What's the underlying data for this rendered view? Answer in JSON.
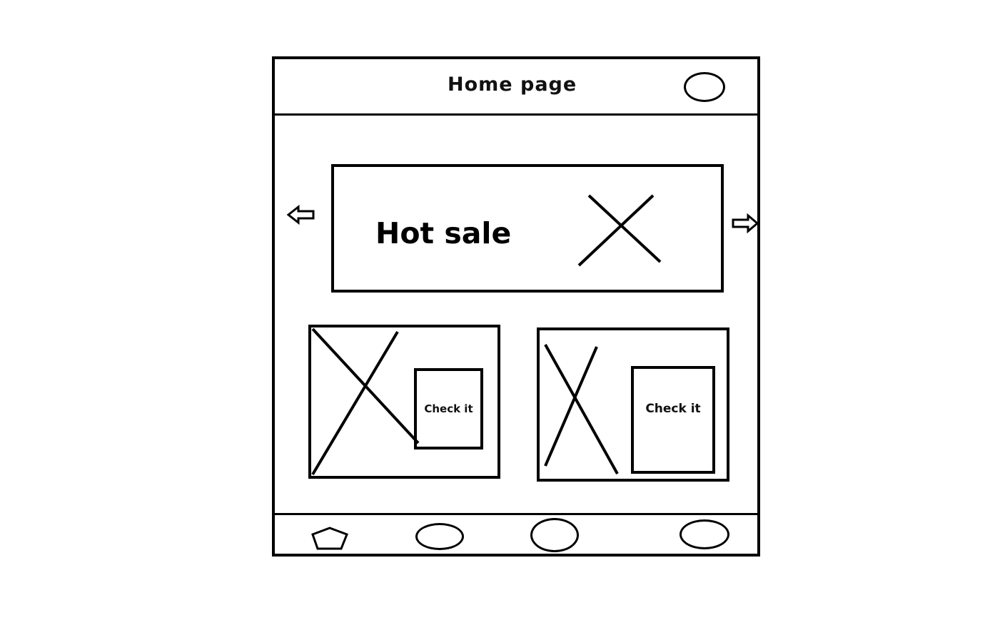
{
  "header": {
    "title": "Home page",
    "profile_icon": "circle-placeholder-icon"
  },
  "carousel": {
    "prev_icon": "arrow-left-icon",
    "next_icon": "arrow-right-icon",
    "banner": {
      "title": "Hot sale",
      "image_icon": "image-placeholder-icon"
    }
  },
  "cards": [
    {
      "image_icon": "image-placeholder-icon",
      "button_label": "Check it"
    },
    {
      "image_icon": "image-placeholder-icon",
      "button_label": "Check it"
    }
  ],
  "bottom_nav": {
    "items": [
      {
        "icon": "pentagon-home-icon"
      },
      {
        "icon": "circle-placeholder-icon"
      },
      {
        "icon": "circle-placeholder-icon"
      },
      {
        "icon": "circle-placeholder-icon"
      }
    ]
  },
  "colors": {
    "stroke": "#000000",
    "background": "#ffffff"
  }
}
